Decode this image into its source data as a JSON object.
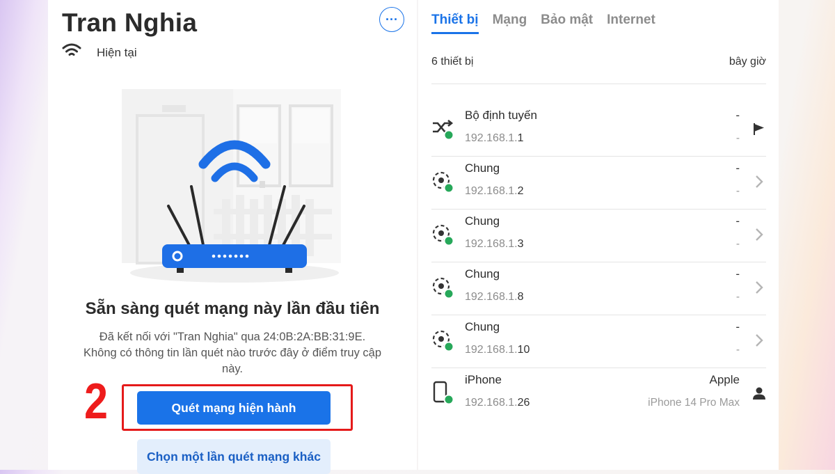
{
  "network": {
    "name": "Tran Nghia",
    "status": "Hiện tại"
  },
  "scan_prompt": {
    "headline": "Sẵn sàng quét mạng này lần đầu tiên",
    "description": "Đã kết nối với \"Tran Nghia\" qua 24:0B:2A:BB:31:9E. Không có thông tin lần quét nào trước đây ở điểm truy cập này.",
    "primary_button": "Quét mạng hiện hành",
    "secondary_button": "Chọn một lần quét mạng khác"
  },
  "callout": {
    "number": "2",
    "color": "#ee1c1c"
  },
  "tabs": [
    {
      "label": "Thiết bị",
      "active": true
    },
    {
      "label": "Mạng",
      "active": false
    },
    {
      "label": "Bảo mật",
      "active": false
    },
    {
      "label": "Internet",
      "active": false
    }
  ],
  "summary": {
    "count": "6 thiết bị",
    "time": "bây giờ"
  },
  "devices": [
    {
      "name": "Bộ định tuyến",
      "ip_prefix": "192.168.1.",
      "ip_last": "1",
      "right_top": "-",
      "right_bottom": "-",
      "icon": "router-shuffle-icon",
      "action_icon": "flag-icon"
    },
    {
      "name": "Chung",
      "ip_prefix": "192.168.1.",
      "ip_last": "2",
      "right_top": "-",
      "right_bottom": "-",
      "icon": "generic-device-icon",
      "action_icon": "chevron-right-icon"
    },
    {
      "name": "Chung",
      "ip_prefix": "192.168.1.",
      "ip_last": "3",
      "right_top": "-",
      "right_bottom": "-",
      "icon": "generic-device-icon",
      "action_icon": "chevron-right-icon"
    },
    {
      "name": "Chung",
      "ip_prefix": "192.168.1.",
      "ip_last": "8",
      "right_top": "-",
      "right_bottom": "-",
      "icon": "generic-device-icon",
      "action_icon": "chevron-right-icon"
    },
    {
      "name": "Chung",
      "ip_prefix": "192.168.1.",
      "ip_last": "10",
      "right_top": "-",
      "right_bottom": "-",
      "icon": "generic-device-icon",
      "action_icon": "chevron-right-icon"
    },
    {
      "name": "iPhone",
      "ip_prefix": "192.168.1.",
      "ip_last": "26",
      "right_top": "Apple",
      "right_bottom": "iPhone 14 Pro Max",
      "icon": "phone-icon",
      "action_icon": "person-icon"
    }
  ],
  "colors": {
    "accent": "#1a73e8",
    "online": "#27a85a",
    "highlight": "#e51a1a"
  }
}
